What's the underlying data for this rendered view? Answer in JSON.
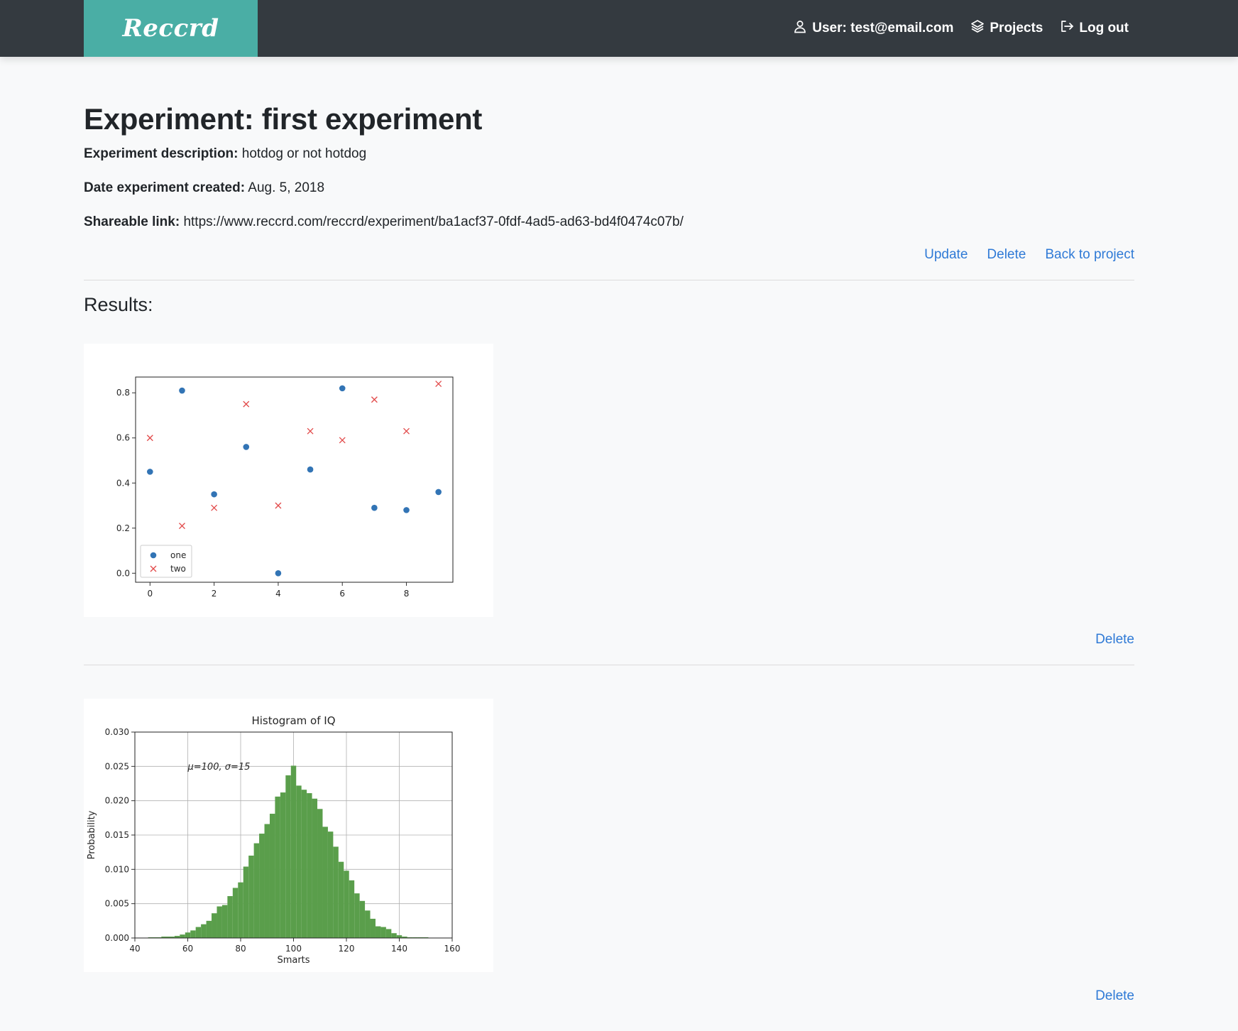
{
  "nav": {
    "brand": "Reccrd",
    "user": "User: test@email.com",
    "projects": "Projects",
    "logout": "Log out"
  },
  "experiment": {
    "title": "Experiment: first experiment",
    "description_label": "Experiment description:",
    "description": "hotdog or not hotdog",
    "date_label": "Date experiment created:",
    "date": "Aug. 5, 2018",
    "link_label": "Shareable link:",
    "link": "https://www.reccrd.com/reccrd/experiment/ba1acf37-0fdf-4ad5-ad63-bd4f0474c07b/"
  },
  "actions": {
    "update": "Update",
    "delete": "Delete",
    "back": "Back to project"
  },
  "results": {
    "heading": "Results:",
    "delete_label": "Delete"
  },
  "icons": {
    "user": "user-icon",
    "projects": "layers-icon",
    "logout": "logout-icon"
  },
  "colors": {
    "brand": "#4aaea5",
    "navbar": "#343a40",
    "link": "#2f7ad6",
    "series_one": "#3274b5",
    "series_two": "#e24a4a",
    "hist": "#5a9e4b"
  },
  "chart_data": [
    {
      "type": "scatter",
      "title": "",
      "xlabel": "",
      "ylabel": "",
      "xlim": [
        -0.45,
        9.45
      ],
      "ylim": [
        -0.04,
        0.87
      ],
      "xticks": [
        "0",
        "2",
        "4",
        "6",
        "8"
      ],
      "yticks": [
        "0.0",
        "0.2",
        "0.4",
        "0.6",
        "0.8"
      ],
      "legend": "lower-left",
      "series": [
        {
          "name": "one",
          "marker": "circle",
          "x": [
            0,
            1,
            2,
            3,
            4,
            5,
            6,
            7,
            8,
            9
          ],
          "y": [
            0.45,
            0.81,
            0.35,
            0.56,
            0.0,
            0.46,
            0.82,
            0.29,
            0.28,
            0.36
          ]
        },
        {
          "name": "two",
          "marker": "x",
          "x": [
            0,
            1,
            2,
            3,
            4,
            5,
            6,
            7,
            8,
            9
          ],
          "y": [
            0.6,
            0.21,
            0.29,
            0.75,
            0.3,
            0.63,
            0.59,
            0.77,
            0.63,
            0.84
          ]
        }
      ]
    },
    {
      "type": "bar",
      "title": "Histogram of IQ",
      "xlabel": "Smarts",
      "ylabel": "Probability",
      "annotation": "μ=100,  σ=15",
      "grid": true,
      "xlim": [
        40,
        160
      ],
      "ylim": [
        0,
        0.03
      ],
      "xticks": [
        "40",
        "60",
        "80",
        "100",
        "120",
        "140",
        "160"
      ],
      "yticks": [
        "0.000",
        "0.005",
        "0.010",
        "0.015",
        "0.020",
        "0.025",
        "0.030"
      ],
      "bin_edges": [
        45,
        50,
        55,
        57,
        59,
        61,
        63,
        65,
        67,
        69,
        71,
        73,
        75,
        77,
        79,
        81,
        83,
        85,
        87,
        89,
        91,
        93,
        95,
        97,
        99,
        101,
        103,
        105,
        107,
        109,
        111,
        113,
        115,
        117,
        119,
        121,
        123,
        125,
        127,
        129,
        131,
        133,
        135,
        137,
        139,
        141,
        143,
        145,
        147,
        149,
        151
      ],
      "values": [
        0.0001,
        0.0002,
        0.0003,
        0.0005,
        0.0008,
        0.0011,
        0.0016,
        0.002,
        0.0025,
        0.0036,
        0.0046,
        0.0048,
        0.0061,
        0.0073,
        0.0081,
        0.0104,
        0.012,
        0.0138,
        0.0152,
        0.0166,
        0.0181,
        0.0206,
        0.0212,
        0.0237,
        0.0251,
        0.0222,
        0.0216,
        0.0211,
        0.0203,
        0.0188,
        0.0162,
        0.0155,
        0.0133,
        0.0111,
        0.0098,
        0.0084,
        0.0065,
        0.0054,
        0.004,
        0.0028,
        0.0017,
        0.0016,
        0.0013,
        0.0007,
        0.0004,
        0.0002,
        0.0001,
        0.0001,
        0.0001,
        0.0001
      ]
    }
  ]
}
